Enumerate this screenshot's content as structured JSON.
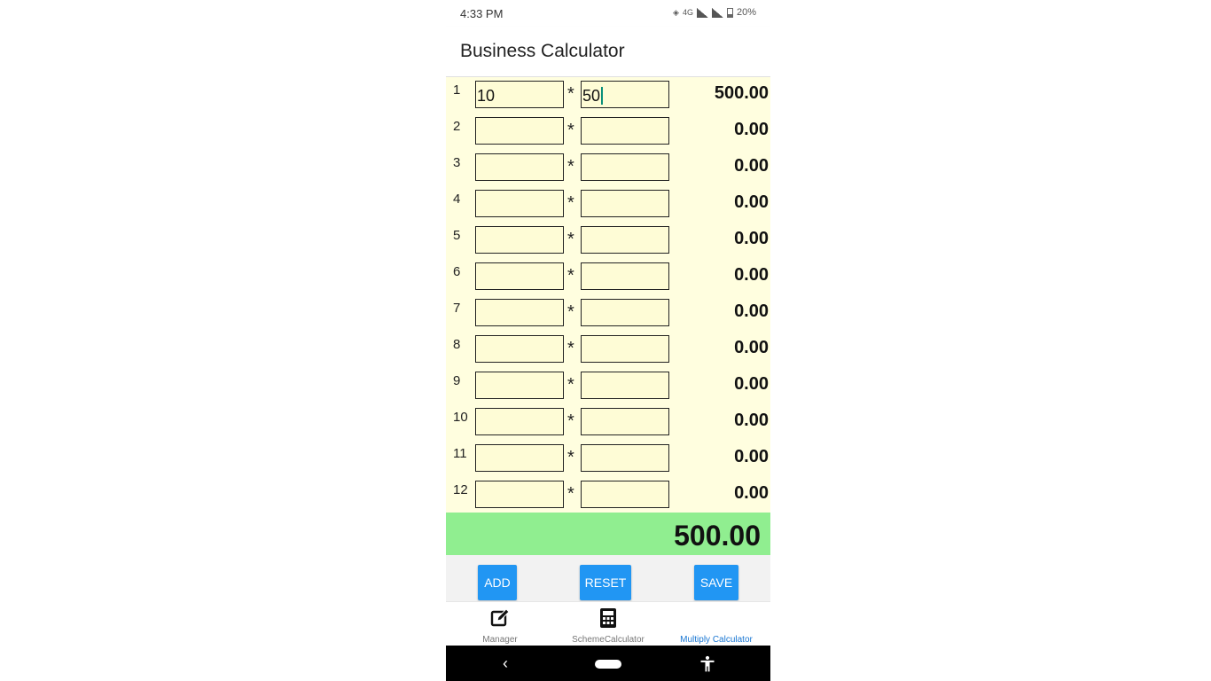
{
  "status_bar": {
    "time": "4:33 PM",
    "network_label": "4G",
    "battery": "20%"
  },
  "app_bar": {
    "title": "Business Calculator"
  },
  "rows": [
    {
      "num": "1",
      "a": "10",
      "b": "50",
      "result": "500.00"
    },
    {
      "num": "2",
      "a": "",
      "b": "",
      "result": "0.00"
    },
    {
      "num": "3",
      "a": "",
      "b": "",
      "result": "0.00"
    },
    {
      "num": "4",
      "a": "",
      "b": "",
      "result": "0.00"
    },
    {
      "num": "5",
      "a": "",
      "b": "",
      "result": "0.00"
    },
    {
      "num": "6",
      "a": "",
      "b": "",
      "result": "0.00"
    },
    {
      "num": "7",
      "a": "",
      "b": "",
      "result": "0.00"
    },
    {
      "num": "8",
      "a": "",
      "b": "",
      "result": "0.00"
    },
    {
      "num": "9",
      "a": "",
      "b": "",
      "result": "0.00"
    },
    {
      "num": "10",
      "a": "",
      "b": "",
      "result": "0.00"
    },
    {
      "num": "11",
      "a": "",
      "b": "",
      "result": "0.00"
    },
    {
      "num": "12",
      "a": "",
      "b": "",
      "result": "0.00"
    }
  ],
  "operator": "*",
  "total": "500.00",
  "buttons": {
    "add": "ADD",
    "reset": "RESET",
    "save": "SAVE"
  },
  "bottom_nav": [
    {
      "label": "Manager",
      "icon": "edit-icon",
      "active": false
    },
    {
      "label": "SchemeCalculator",
      "icon": "calculator-icon",
      "active": false
    },
    {
      "label": "Multiply Calculator",
      "icon": "",
      "active": true
    }
  ],
  "colors": {
    "accent": "#2196f3",
    "total_bg": "#90ee90",
    "rows_bg": "#fffedf",
    "active_tab": "#1976d2"
  }
}
